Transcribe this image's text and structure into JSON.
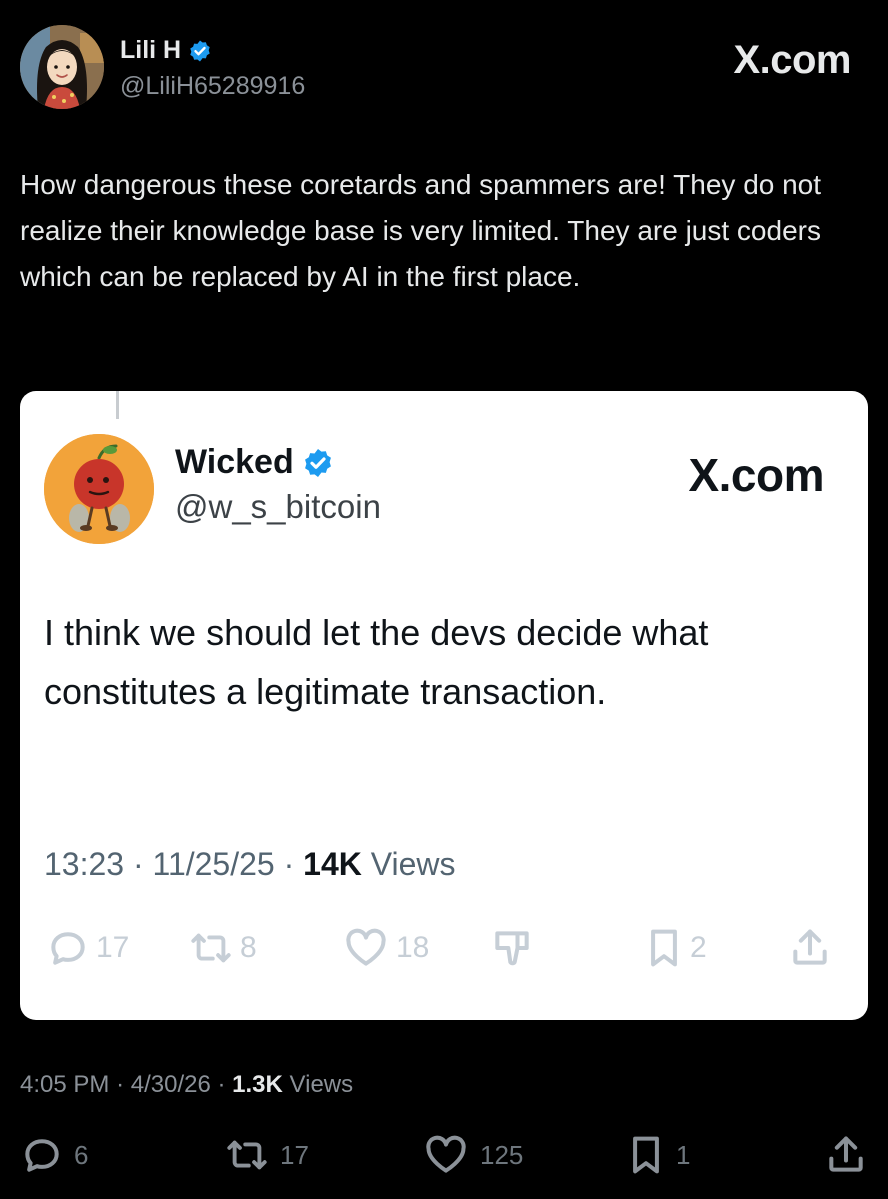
{
  "post": {
    "author": {
      "name": "Lili H",
      "handle": "@LiliH65289916",
      "verified": true
    },
    "brand": "X.com",
    "text": "How dangerous these coretards and spammers are! They do not realize their knowledge base is very limited. They are just coders which can be replaced by AI in the first place.",
    "time": "4:05 PM",
    "date": "4/30/26",
    "views_count": "1.3K",
    "views_label": "Views",
    "separator": "·",
    "actions": {
      "replies": "6",
      "reposts": "17",
      "likes": "125",
      "bookmarks": "1"
    }
  },
  "quoted": {
    "author": {
      "name": "Wicked",
      "handle": "@w_s_bitcoin",
      "verified": true
    },
    "brand": "X.com",
    "text": "I think we should let the devs decide what constitutes a legitimate transaction.",
    "time": "13:23",
    "date": "11/25/25",
    "views_count": "14K",
    "views_label": "Views",
    "separator": "·",
    "actions": {
      "replies": "17",
      "reposts": "8",
      "likes": "18",
      "bookmarks": "2"
    }
  },
  "colors": {
    "background": "#000000",
    "card_background": "#ffffff",
    "verified_badge": "#1d9bf0",
    "muted_text": "#8b9198"
  },
  "icons": [
    "verified-badge-icon",
    "reply-icon",
    "repost-icon",
    "like-icon",
    "dislike-icon",
    "bookmark-icon",
    "share-icon"
  ]
}
